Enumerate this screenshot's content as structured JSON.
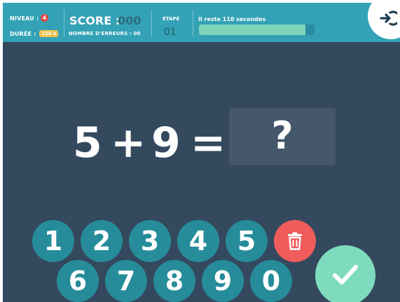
{
  "header": {
    "niveau_label": "NIVEAU :",
    "niveau_value": "4",
    "duree_label": "DURÉE :",
    "duree_value": "120 s",
    "score_label": "SCORE :",
    "score_value": "000",
    "errors_label": "NOMBRE D'ERREURS : 00",
    "etape_label": "ÉTAPE",
    "etape_value": "01",
    "timer_text": "Il reste 110 secondes",
    "timer_progress": 0.92
  },
  "equation": {
    "left": "5",
    "operator": "+",
    "right": "9",
    "equals": "=",
    "answer": "?"
  },
  "keypad": {
    "keys": [
      "1",
      "2",
      "3",
      "4",
      "5",
      "6",
      "7",
      "8",
      "9",
      "0"
    ],
    "delete_icon": "trash-icon",
    "validate_icon": "check-icon",
    "exit_icon": "exit-icon"
  },
  "colors": {
    "background": "#34495e",
    "header": "#34a2b6",
    "key": "#268c9a",
    "delete": "#f05c5c",
    "validate": "#7fdbbd",
    "progress": "#7ed3ba"
  }
}
